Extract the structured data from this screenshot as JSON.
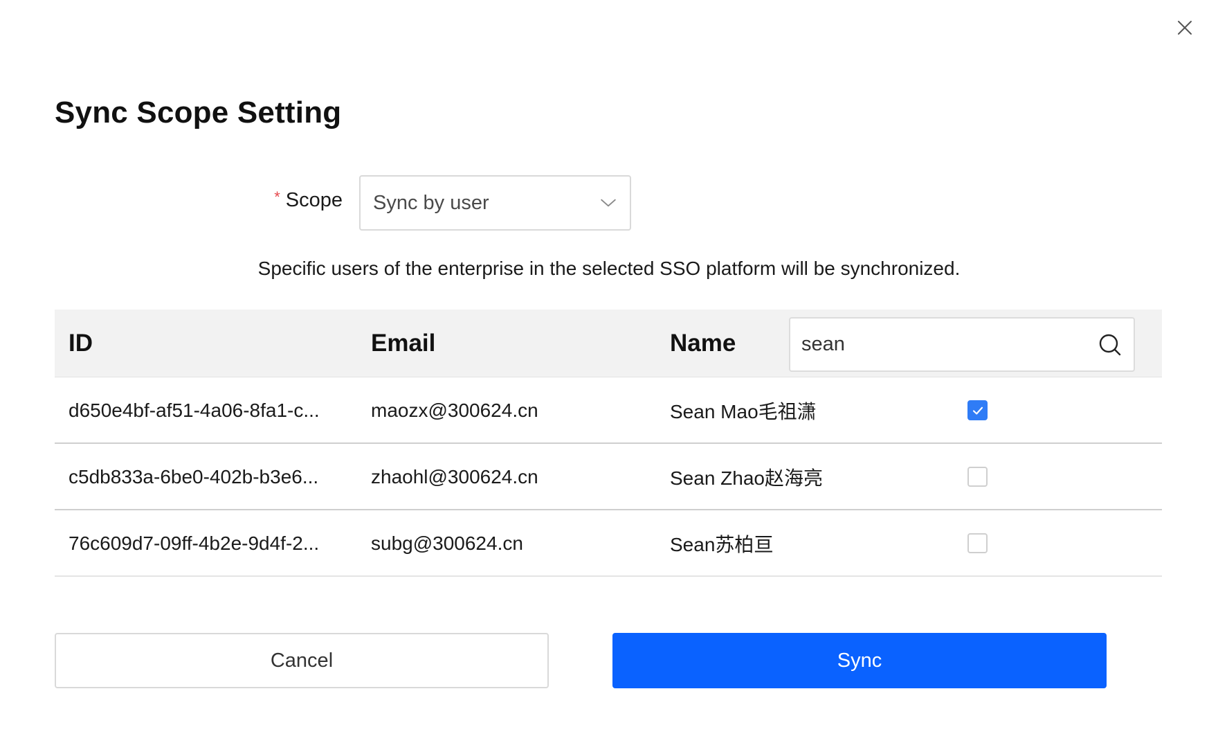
{
  "dialog": {
    "title": "Sync Scope Setting"
  },
  "scope": {
    "required_mark": "*",
    "label": "Scope",
    "selected": "Sync by user"
  },
  "description": "Specific users of the enterprise in the selected SSO platform will be synchronized.",
  "table": {
    "headers": {
      "id": "ID",
      "email": "Email",
      "name": "Name"
    },
    "search": {
      "value": "sean"
    },
    "rows": [
      {
        "id": "d650e4bf-af51-4a06-8fa1-c...",
        "email": "maozx@300624.cn",
        "name": "Sean Mao毛祖潇",
        "checked": true
      },
      {
        "id": "c5db833a-6be0-402b-b3e6...",
        "email": "zhaohl@300624.cn",
        "name": "Sean Zhao赵海亮",
        "checked": false
      },
      {
        "id": "76c609d7-09ff-4b2e-9d4f-2...",
        "email": "subg@300624.cn",
        "name": "Sean苏柏亘",
        "checked": false
      }
    ]
  },
  "buttons": {
    "cancel": "Cancel",
    "sync": "Sync"
  },
  "colors": {
    "primary": "#0a62ff",
    "checkbox_checked": "#2f7cf6",
    "required": "#e5484d",
    "header_bg": "#f2f2f2"
  },
  "icons": {
    "close": "close-icon",
    "dropdown": "chevron-down-icon",
    "search": "search-icon",
    "check": "checkmark-icon"
  }
}
